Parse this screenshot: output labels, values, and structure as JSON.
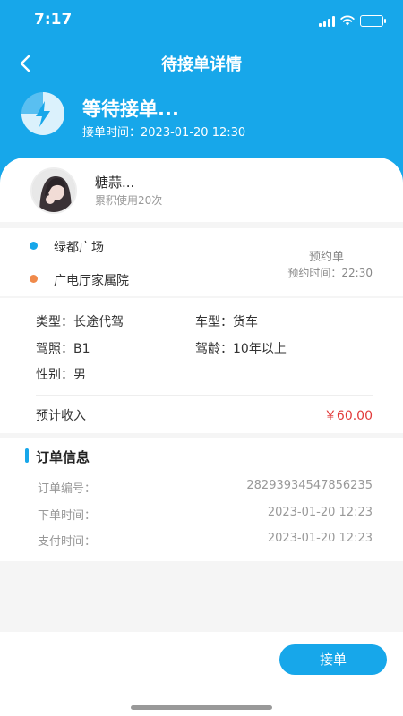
{
  "status_bar": {
    "time": "7:17"
  },
  "nav": {
    "title": "待接单详情"
  },
  "order_status": {
    "title": "等待接单...",
    "time_label": "接单时间：",
    "time_value": "2023-01-20  12:30",
    "icon": "lightning-icon"
  },
  "user": {
    "name": "糖蒜...",
    "usage": "累积使用20次"
  },
  "route": {
    "start": "绿都广场",
    "end": "广电厅家属院",
    "start_color": "#17a7ea",
    "end_color": "#f08a4b",
    "order_type": "预约单",
    "book_time_label": "预约时间：",
    "book_time_value": "22:30"
  },
  "details": {
    "type_label": "类型：",
    "type_value": "长途代驾",
    "car_label": "车型：",
    "car_value": "货车",
    "license_label": "驾照：",
    "license_value": "B1",
    "age_label": "驾龄：",
    "age_value": "10年以上",
    "gender_label": "性别：",
    "gender_value": "男",
    "income_label": "预计收入",
    "income_value": "￥60.00"
  },
  "order_info": {
    "title": "订单信息",
    "rows": [
      {
        "label": "订单编号：",
        "value": "28293934547856235"
      },
      {
        "label": "下单时间：",
        "value": "2023-01-20  12:23"
      },
      {
        "label": "支付时间：",
        "value": "2023-01-20  12:23"
      }
    ]
  },
  "actions": {
    "accept_label": "接单"
  },
  "colors": {
    "primary": "#17a7ea",
    "price": "#e23b3b"
  }
}
